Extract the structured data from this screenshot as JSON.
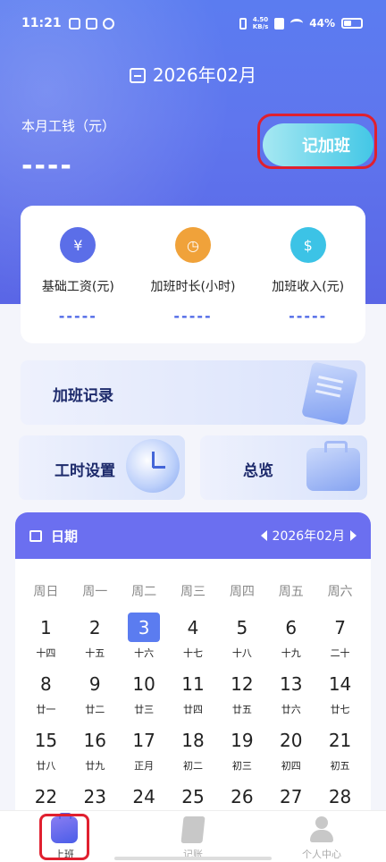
{
  "status_bar": {
    "time": "11:21",
    "net_speed_top": "4.50",
    "net_speed_bottom": "KB/s",
    "battery": "44%"
  },
  "header": {
    "month": "2026年02月",
    "monthly_label": "本月工钱（元）",
    "monthly_value": "----",
    "overtime_button": "记加班"
  },
  "stats": [
    {
      "label": "基础工资(元)",
      "value": "-----",
      "icon": "wage-doc-icon",
      "color": "#5b6ee8"
    },
    {
      "label": "加班时长(小时)",
      "value": "-----",
      "icon": "clock-icon",
      "color": "#f0a23a"
    },
    {
      "label": "加班收入(元)",
      "value": "-----",
      "icon": "income-doc-icon",
      "color": "#3cc3e6"
    }
  ],
  "cards": {
    "overtime_records": "加班记录",
    "work_hours_settings": "工时设置",
    "overview": "总览"
  },
  "calendar": {
    "title": "日期",
    "month": "2026年02月",
    "weekdays": [
      "周日",
      "周一",
      "周二",
      "周三",
      "周四",
      "周五",
      "周六"
    ],
    "today": "3",
    "days": [
      {
        "num": "1",
        "lunar": "十四"
      },
      {
        "num": "2",
        "lunar": "十五"
      },
      {
        "num": "3",
        "lunar": "十六"
      },
      {
        "num": "4",
        "lunar": "十七"
      },
      {
        "num": "5",
        "lunar": "十八"
      },
      {
        "num": "6",
        "lunar": "十九"
      },
      {
        "num": "7",
        "lunar": "二十"
      },
      {
        "num": "8",
        "lunar": "廿一"
      },
      {
        "num": "9",
        "lunar": "廿二"
      },
      {
        "num": "10",
        "lunar": "廿三"
      },
      {
        "num": "11",
        "lunar": "廿四"
      },
      {
        "num": "12",
        "lunar": "廿五"
      },
      {
        "num": "13",
        "lunar": "廿六"
      },
      {
        "num": "14",
        "lunar": "廿七"
      },
      {
        "num": "15",
        "lunar": "廿八"
      },
      {
        "num": "16",
        "lunar": "廿九"
      },
      {
        "num": "17",
        "lunar": "正月"
      },
      {
        "num": "18",
        "lunar": "初二"
      },
      {
        "num": "19",
        "lunar": "初三"
      },
      {
        "num": "20",
        "lunar": "初四"
      },
      {
        "num": "21",
        "lunar": "初五"
      },
      {
        "num": "22",
        "lunar": ""
      },
      {
        "num": "23",
        "lunar": ""
      },
      {
        "num": "24",
        "lunar": ""
      },
      {
        "num": "25",
        "lunar": ""
      },
      {
        "num": "26",
        "lunar": ""
      },
      {
        "num": "27",
        "lunar": ""
      },
      {
        "num": "28",
        "lunar": ""
      }
    ]
  },
  "tabbar": [
    {
      "label": "上班",
      "icon": "briefcase-icon",
      "active": true
    },
    {
      "label": "记账",
      "icon": "notebook-icon",
      "active": false
    },
    {
      "label": "个人中心",
      "icon": "person-icon",
      "active": false
    }
  ]
}
